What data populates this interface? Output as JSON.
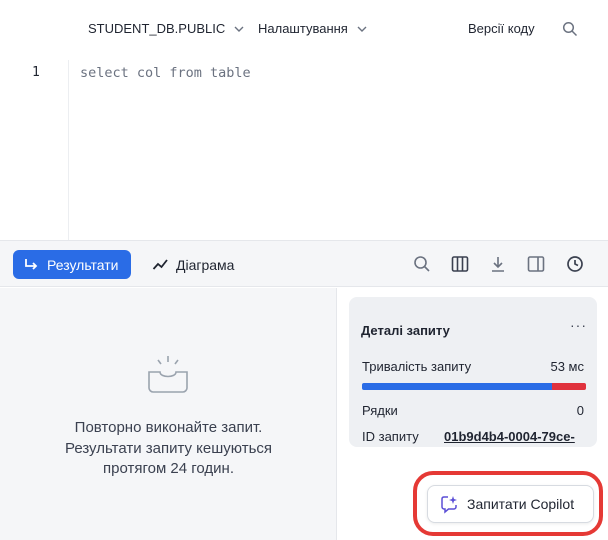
{
  "toolbar": {
    "database": "STUDENT_DB.PUBLIC",
    "settings": "Налаштування",
    "versions": "Версії коду"
  },
  "editor": {
    "line_number": "1",
    "code": "select col from table"
  },
  "results_tabs": {
    "results": "Результати",
    "chart": "Діаграма"
  },
  "empty_state": {
    "line1": "Повторно виконайте запит.",
    "line2": "Результати запиту кешуються",
    "line3": "протягом 24 годин."
  },
  "query_details": {
    "title": "Деталі запиту",
    "more": "···",
    "duration_label": "Тривалість запиту",
    "duration_value": "53 мс",
    "duration_bar_fraction": 0.85,
    "rows_label": "Рядки",
    "rows_value": "0",
    "id_label": "ID запиту",
    "id_value": "01b9d4b4-0004-79ce-"
  },
  "copilot": {
    "label": "Запитати Copilot"
  },
  "colors": {
    "accent": "#2a6ce6",
    "duration_red": "#e0323d",
    "highlight_ring": "#e53935"
  }
}
